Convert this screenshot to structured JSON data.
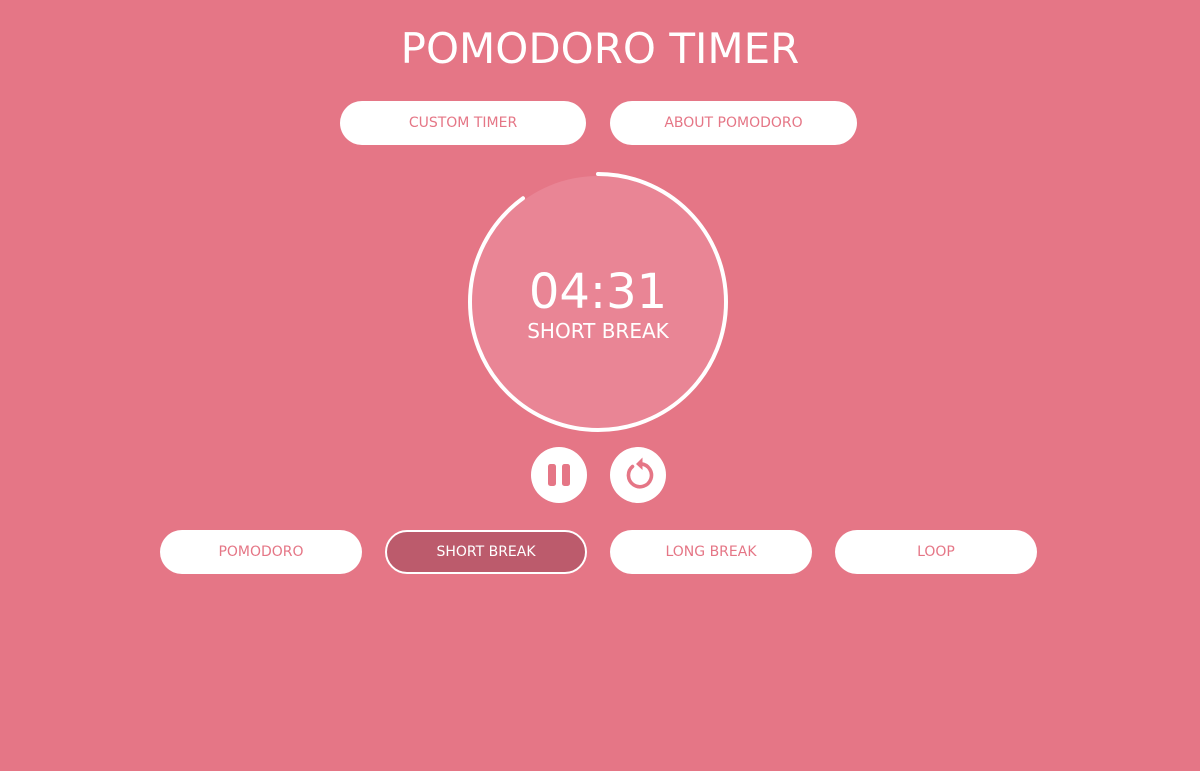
{
  "app": {
    "title": "POMODORO TIMER"
  },
  "top_buttons": {
    "custom_timer": "CUSTOM TIMER",
    "about": "ABOUT POMODORO"
  },
  "timer": {
    "time": "04:31",
    "mode_label": "SHORT BREAK",
    "progress_remaining": 0.9
  },
  "controls": {
    "pause_icon": "pause-icon",
    "reset_icon": "reset-icon"
  },
  "modes": {
    "pomodoro": "POMODORO",
    "short_break": "SHORT BREAK",
    "long_break": "LONG BREAK",
    "loop": "LOOP",
    "active": "short_break"
  },
  "colors": {
    "background": "#e57686",
    "accent": "#ffffff",
    "active_button": "#bc5b6c",
    "dial_fill": "#e98595"
  }
}
